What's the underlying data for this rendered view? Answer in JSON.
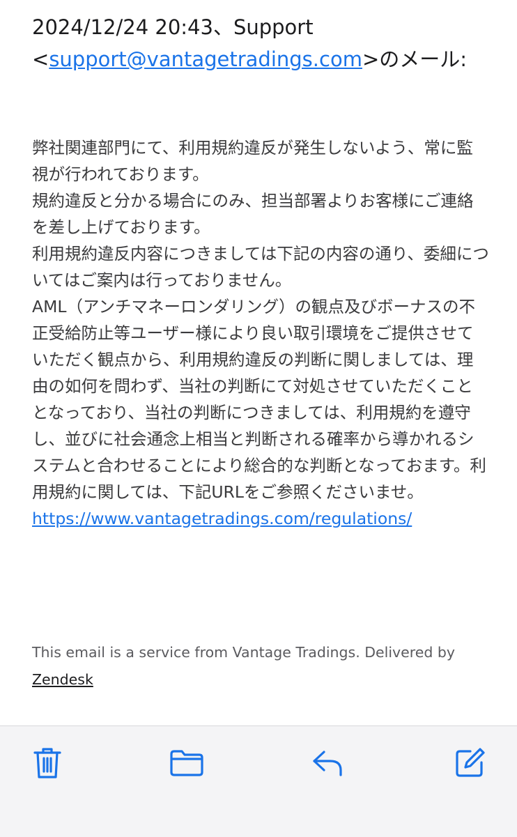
{
  "email": {
    "quote_header_prefix": "2024/12/24 20:43、Support <",
    "quote_header_email": "support@vantagetradings.com",
    "quote_header_suffix": ">のメール:",
    "paragraphs": [
      "弊社関連部門にて、利用規約違反が発生しないよう、常に監視が行われております。",
      "規約違反と分かる場合にのみ、担当部署よりお客様にご連絡を差し上げております。",
      "利用規約違反内容につきましては下記の内容の通り、委細についてはご案内は行っておりません。",
      "AML（アンチマネーロンダリング）の観点及びボーナスの不正受給防止等ユーザー様により良い取引環境をご提供させていただく観点から、利用規約違反の判断に関しましては、理由の如何を問わず、当社の判断にて対処させていただくこととなっており、当社の判断につきましては、利用規約を遵守し、並びに社会通念上相当と判断される確率から導かれるシステムと合わせることにより総合的な判断となっておます。利用規約に関しては、下記URLをご参照くださいませ。"
    ],
    "link": "https://www.vantagetradings.com/regulations/",
    "footer_text": "This email is a service from Vantage Tradings. Delivered by",
    "footer_link": "Zendesk"
  },
  "toolbar": {
    "icons": [
      "trash-icon",
      "folder-icon",
      "reply-icon",
      "compose-icon"
    ],
    "accent_color": "#1a73e8"
  }
}
